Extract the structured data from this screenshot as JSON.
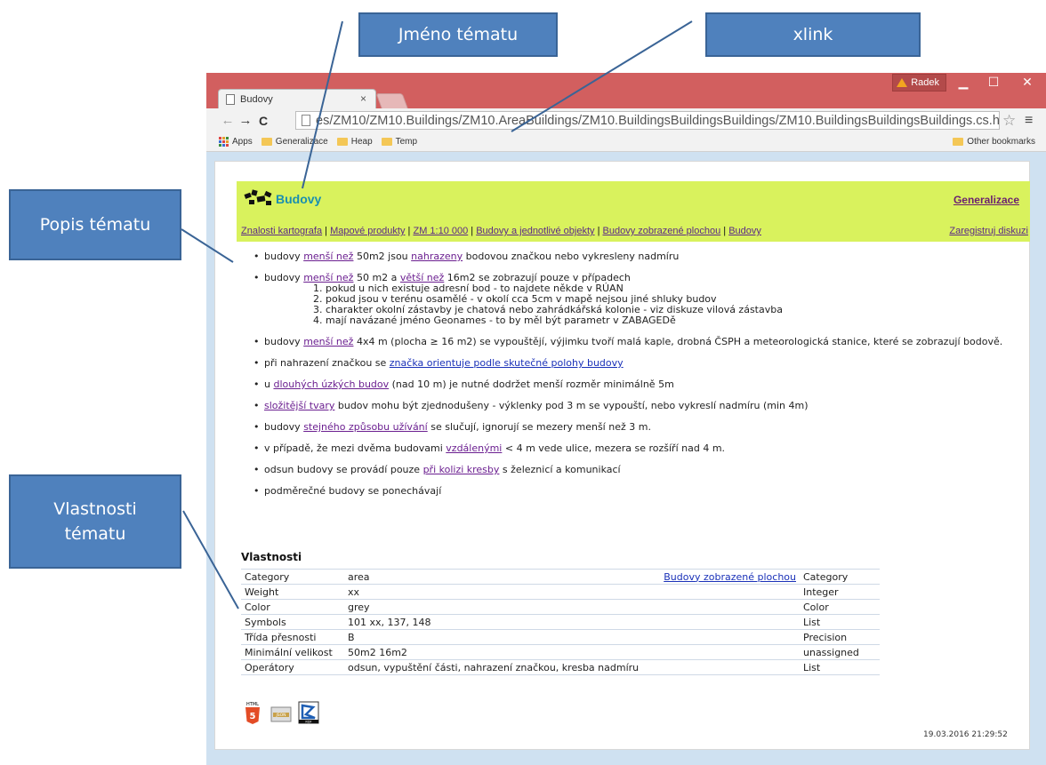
{
  "callouts": {
    "topic_name": "Jméno tématu",
    "xlink": "xlink",
    "topic_description": "Popis tématu",
    "topic_properties": "Vlastnosti tématu"
  },
  "window": {
    "user": "Radek",
    "tab_title": "Budovy",
    "url": "es/ZM10/ZM10.Buildings/ZM10.AreaBuildings/ZM10.BuildingsBuildingsBuildings/ZM10.BuildingsBuildingsBuildings.cs.html",
    "bookmarks": [
      "Apps",
      "Generalizace",
      "Heap",
      "Temp"
    ],
    "other_bookmarks": "Other bookmarks"
  },
  "header": {
    "title": "Budovy",
    "generalizace": "Generalizace",
    "breadcrumbs": [
      "Znalosti kartografa",
      "Mapové produkty",
      "ZM 1:10 000",
      "Budovy a jednotlivé objekty",
      "Budovy zobrazené plochou",
      "Budovy"
    ],
    "register": "Zaregistruj diskuzi"
  },
  "description": {
    "b1": {
      "p1": "budovy ",
      "l1": "menší než",
      "p2": " 50m2 jsou ",
      "l2": "nahrazeny",
      "p3": " bodovou značkou nebo vykresleny nadmíru"
    },
    "b2": {
      "p1": "budovy ",
      "l1": "menší než",
      "p2": " 50 m2 a ",
      "l2": "větší než",
      "p3": " 16m2 se zobrazují pouze v případech",
      "items": [
        "1. pokud u nich existuje adresní bod - to najdete někde v RÚAN",
        "2. pokud jsou v terénu osamělé - v okolí cca 5cm v mapě nejsou jiné shluky budov",
        "3. charakter okolní zástavby je chatová nebo zahrádkářská kolonie - viz diskuze vilová zástavba",
        "4. mají navázané jméno Geonames - to by měl být parametr v ZABAGEDě"
      ]
    },
    "b3": {
      "p1": "budovy ",
      "l1": "menší než",
      "p2": " 4x4 m (plocha ≥ 16 m2) se vypouštějí, výjimku tvoří malá kaple, drobná ČSPH a meteorologická stanice, které se zobrazují bodově."
    },
    "b4": {
      "p1": "při nahrazení značkou se ",
      "l1": "značka orientuje podle skutečné polohy budovy"
    },
    "b5": {
      "p1": "u ",
      "l1": "dlouhých úzkých budov",
      "p2": " (nad 10 m) je nutné dodržet menší rozměr minimálně 5m"
    },
    "b6": {
      "l1": "složitější tvary",
      "p1": " budov mohu být zjednodušeny - výklenky pod 3 m se vypouští, nebo vykreslí nadmíru (min 4m)"
    },
    "b7": {
      "p1": "budovy ",
      "l1": "stejného způsobu užívání",
      "p2": " se slučují, ignorují se mezery menší než 3 m."
    },
    "b8": {
      "p1": "v případě, že mezi dvěma budovami ",
      "l1": "vzdálenými",
      "p2": " < 4 m vede ulice, mezera se rozšíří nad 4 m."
    },
    "b9": {
      "p1": "odsun budovy se provádí pouze ",
      "l1": "při kolizi kresby",
      "p2": " s železnicí a komunikací"
    },
    "b10": {
      "p1": "podměrečné budovy se ponechávají"
    }
  },
  "properties": {
    "title": "Vlastnosti",
    "rows": [
      {
        "name": "Category",
        "value": "area",
        "link": "Budovy zobrazené plochou",
        "type": "Category"
      },
      {
        "name": "Weight",
        "value": "xx",
        "link": "",
        "type": "Integer"
      },
      {
        "name": "Color",
        "value": "grey",
        "link": "",
        "type": "Color"
      },
      {
        "name": "Symbols",
        "value": "101 xx, 137, 148",
        "link": "",
        "type": "List"
      },
      {
        "name": "Třída přesnosti",
        "value": "B",
        "link": "",
        "type": "Precision"
      },
      {
        "name": "Minimální velikost",
        "value": "50m2 16m2",
        "link": "",
        "type": "unassigned"
      },
      {
        "name": "Operátory",
        "value": "odsun, vypuštění části, nahrazení značkou, kresba nadmíru",
        "link": "",
        "type": "List"
      }
    ]
  },
  "footer": {
    "formats": [
      "HTML",
      "JSON",
      "RDF"
    ],
    "timestamp": "19.03.2016 21:29:52"
  }
}
